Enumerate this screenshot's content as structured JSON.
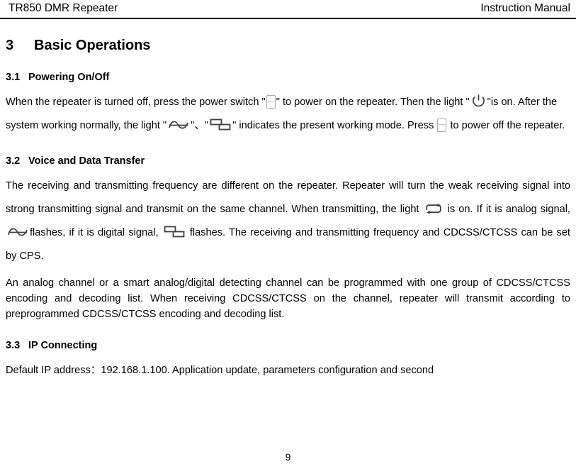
{
  "header": {
    "left_title": "TR850 DMR Repeater",
    "right_title": "Instruction Manual"
  },
  "section": {
    "number": "3",
    "title": "Basic Operations"
  },
  "subsections": [
    {
      "number": "3.1",
      "title": "Powering On/Off",
      "paragraph": {
        "part1": "When the repeater is turned off, press the power switch \"",
        "icon1": "power-switch-icon",
        "part2": "\" to power on the repeater. Then the light \"",
        "icon2": "power-symbol-icon",
        "part3": "\"is on. After the system working normally, the light \"",
        "icon3": "analog-wave-icon",
        "part4": "\"、\"",
        "icon4": "digital-signal-icon",
        "part5": "\"  indicates the present working mode. Press ",
        "icon5": "power-switch-icon",
        "part6": " to power off the repeater."
      }
    },
    {
      "number": "3.2",
      "title": "Voice and Data Transfer",
      "paragraph1": {
        "part1": "The receiving and transmitting frequency are different on the repeater. Repeater will turn the weak receiving signal into strong transmitting signal and transmit on the same channel. When transmitting, the light ",
        "icon1": "transmit-loop-icon",
        "part2": " is on. If it is analog signal, ",
        "icon2": "analog-wave-icon",
        "part3": "flashes, if it is digital signal, ",
        "icon3": "digital-signal-icon",
        "part4": " flashes. The receiving and transmitting frequency and CDCSS/CTCSS can be set by CPS."
      },
      "paragraph2": "An analog channel or a smart analog/digital detecting channel can be programmed with one group of CDCSS/CTCSS encoding and decoding list. When receiving CDCSS/CTCSS on the channel, repeater will transmit according to preprogrammed CDCSS/CTCSS encoding and decoding list."
    },
    {
      "number": "3.3",
      "title": "IP Connecting",
      "paragraph": "Default IP address：192.168.1.100. Application update, parameters configuration and second"
    }
  ],
  "footer": {
    "page_number": "9"
  },
  "colors": {
    "text": "#000000",
    "icon_gray": "#a8a8a8",
    "icon_dark": "#3f3f3f"
  }
}
